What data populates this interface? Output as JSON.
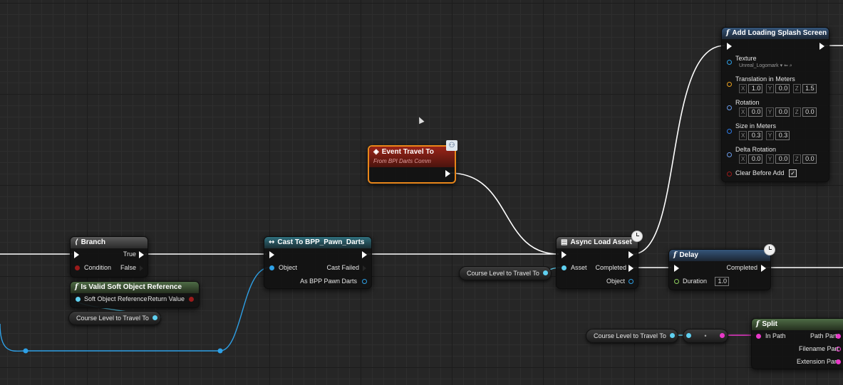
{
  "nodes": {
    "branch": {
      "title": "Branch",
      "true_label": "True",
      "condition_label": "Condition",
      "false_label": "False"
    },
    "is_valid": {
      "title": "Is Valid Soft Object Reference",
      "input_label": "Soft Object Reference",
      "return_label": "Return Value"
    },
    "course_var_1": {
      "label": "Course Level to Travel To"
    },
    "cast": {
      "title": "Cast To BPP_Pawn_Darts",
      "object_label": "Object",
      "cast_failed_label": "Cast Failed",
      "as_label": "As BPP Pawn Darts"
    },
    "event": {
      "title": "Event Travel To",
      "subtitle": "From BPI Darts Comm"
    },
    "async": {
      "title": "Async Load Asset",
      "asset_label": "Asset",
      "completed_label": "Completed",
      "object_label": "Object"
    },
    "course_var_2": {
      "label": "Course Level to Travel To"
    },
    "delay": {
      "title": "Delay",
      "completed_label": "Completed",
      "duration_label": "Duration",
      "duration_value": "1.0"
    },
    "splash": {
      "title": "Add Loading Splash Screen",
      "texture_label": "Texture",
      "texture_value": "Unreal_Logomark",
      "translation_label": "Translation in Meters",
      "translation": [
        "1.0",
        "0.0",
        "1.5"
      ],
      "rotation_label": "Rotation",
      "rotation": [
        "0.0",
        "0.0",
        "0.0"
      ],
      "size_label": "Size in Meters",
      "size": [
        "0.3",
        "0.3"
      ],
      "delta_label": "Delta Rotation",
      "delta": [
        "0.0",
        "0.0",
        "0.0"
      ],
      "clear_label": "Clear Before Add"
    },
    "course_var_3": {
      "label": "Course Level to Travel To"
    },
    "reroute": {
      "label": "•"
    },
    "split": {
      "title": "Split",
      "in_path_label": "In Path",
      "path_part_label": "Path Part",
      "filename_part_label": "Filename Part",
      "extension_part_label": "Extension Part"
    }
  },
  "axis_labels": {
    "x": "X",
    "y": "Y",
    "z": "Z"
  },
  "colors": {
    "exec": "#ffffff",
    "object_pin": "#2ea0e6",
    "soft_object_pin": "#5fd0f0",
    "bool_pin": "#9b1b1b",
    "struct_pin": "#e8a020",
    "float_pin": "#8fcf5f",
    "string_pin": "#e838c8",
    "event_border": "#e8861a"
  }
}
